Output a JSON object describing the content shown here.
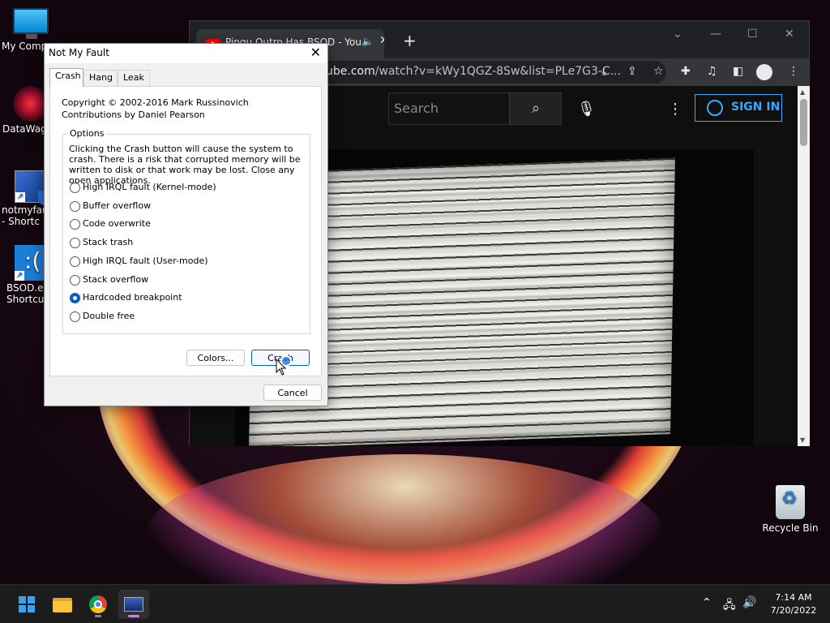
{
  "desktop": {
    "icons": [
      {
        "label": "My Comp",
        "icon": "computer-icon"
      },
      {
        "label": "DataWago",
        "icon": "datawagon-icon"
      },
      {
        "label": "notmyfau\n- Shortc",
        "icon": "notmyfault-icon"
      },
      {
        "label": "BSOD.ex\nShortcu",
        "icon": "bsod-icon"
      },
      {
        "label": "Recycle Bin",
        "icon": "recycle-bin-icon"
      }
    ]
  },
  "browser": {
    "tab_title": "Pingu Outro Has BSOD - You",
    "new_tab": "+",
    "url_host": "ube.com",
    "url_path": "/watch?v=kWy1QGZ-8Sw&list=PLe7G3-C...",
    "youtube": {
      "search_placeholder": "Search",
      "sign_in_label": "SIGN IN"
    }
  },
  "dialog": {
    "title": "Not My Fault",
    "tabs": [
      "Crash",
      "Hang",
      "Leak"
    ],
    "active_tab": "Crash",
    "copyright": "Copyright © 2002-2016 Mark Russinovich",
    "contributions": "Contributions by Daniel Pearson",
    "options_label": "Options",
    "warning": "Clicking the Crash button will cause the system to crash. There is a risk that corrupted memory will be written to disk or that work may be lost. Close any open applications.",
    "options": [
      {
        "label": "High IRQL fault (Kernel-mode)",
        "checked": false
      },
      {
        "label": "Buffer overflow",
        "checked": false
      },
      {
        "label": "Code overwrite",
        "checked": false
      },
      {
        "label": "Stack trash",
        "checked": false
      },
      {
        "label": "High IRQL fault (User-mode)",
        "checked": false
      },
      {
        "label": "Stack overflow",
        "checked": false
      },
      {
        "label": "Hardcoded breakpoint",
        "checked": true
      },
      {
        "label": "Double free",
        "checked": false
      }
    ],
    "colors_button": "Colors...",
    "crash_button": "Crash",
    "cancel_button": "Cancel"
  },
  "taskbar": {
    "time": "7:14 AM",
    "date": "7/20/2022",
    "apps": [
      "start-icon",
      "file-explorer-icon",
      "chrome-icon",
      "notmyfault-icon"
    ]
  },
  "colors": {
    "accent": "#005fb8",
    "youtube_blue": "#3ea6ff",
    "taskbar": "#1c1c1c"
  }
}
